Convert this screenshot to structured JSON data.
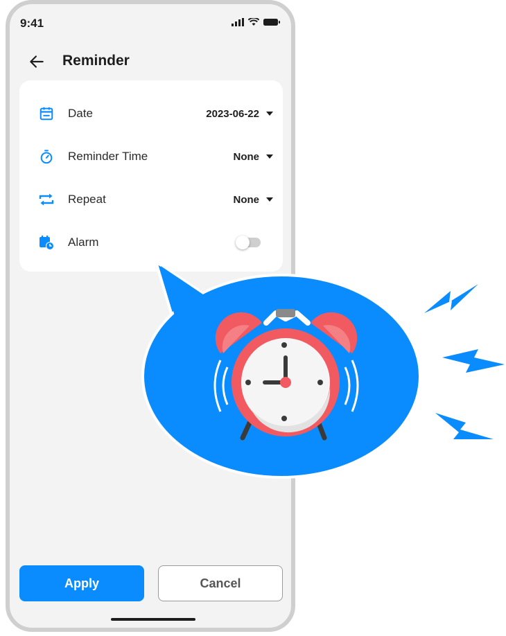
{
  "status_bar": {
    "time": "9:41"
  },
  "header": {
    "title": "Reminder"
  },
  "settings": [
    {
      "icon": "calendar-icon",
      "label": "Date",
      "value": "2023-06-22",
      "control": "dropdown"
    },
    {
      "icon": "timer-icon",
      "label": "Reminder Time",
      "value": "None",
      "control": "dropdown"
    },
    {
      "icon": "repeat-icon",
      "label": "Repeat",
      "value": "None",
      "control": "dropdown"
    },
    {
      "icon": "calendar-clock-icon",
      "label": "Alarm",
      "value": "off",
      "control": "toggle"
    }
  ],
  "buttons": {
    "apply": "Apply",
    "cancel": "Cancel"
  },
  "illustration": {
    "icon": "alarm-clock-icon"
  },
  "colors": {
    "accent": "#0a8cff",
    "bubble": "#0a8cff",
    "clock_red": "#f25a61"
  }
}
